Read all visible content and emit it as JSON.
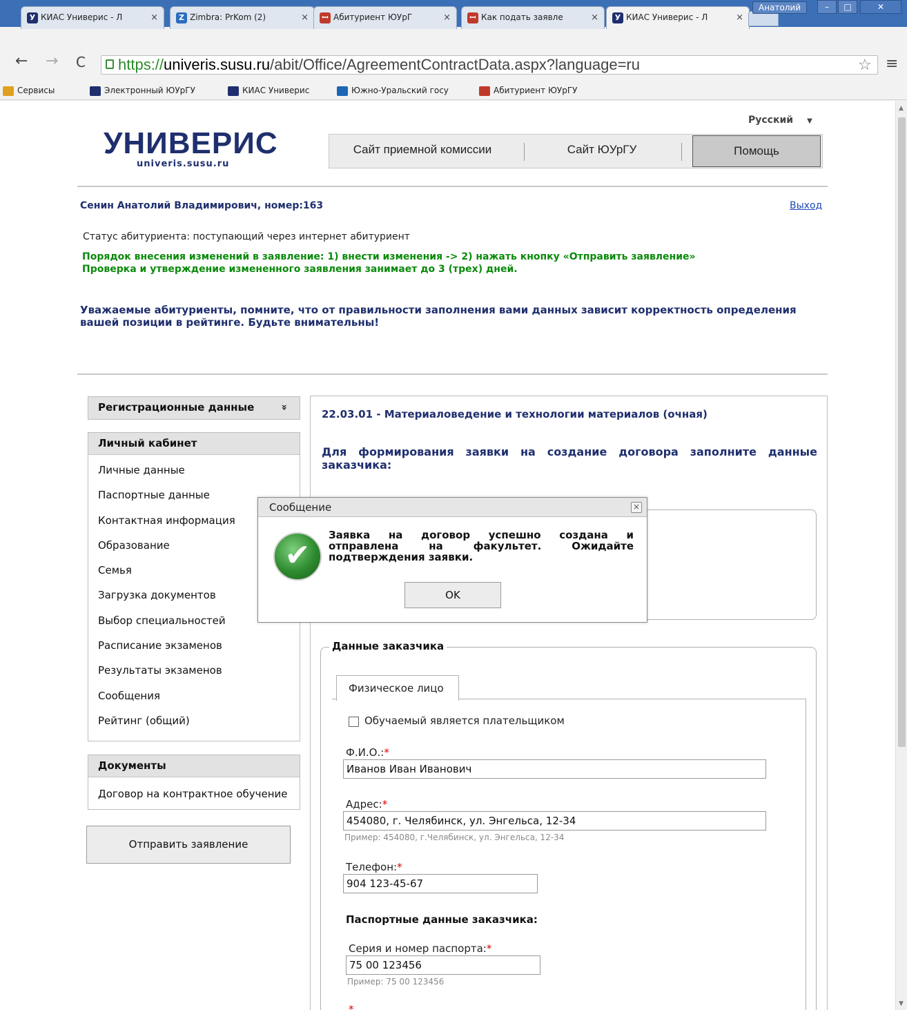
{
  "browser": {
    "tabs": [
      {
        "title": "КИАС Универис - Л",
        "favicon": "univeris-icon",
        "close": "×"
      },
      {
        "title": "Zimbra: PrKom (2)",
        "favicon": "zimbra-icon",
        "close": "×"
      },
      {
        "title": "Абитуриент ЮУрГ",
        "favicon": "susu-icon",
        "close": "×"
      },
      {
        "title": "Как подать заявле",
        "favicon": "susu-icon",
        "close": "×"
      },
      {
        "title": "КИАС Универис - Л",
        "favicon": "univeris-icon",
        "close": "×"
      }
    ],
    "user": "Анатолий",
    "url_scheme": "https://",
    "url_domain": "univeris.susu.ru",
    "url_path": "/abit/Office/AgreementContractData.aspx?language=ru",
    "bookmarks": [
      "Сервисы",
      "Электронный ЮУрГУ",
      "КИАС Универис",
      "Южно-Уральский госу",
      "Абитуриент ЮУрГУ"
    ]
  },
  "header": {
    "logo_main": "УНИВЕРИС",
    "logo_sub": "univeris.susu.ru",
    "language": "Русский",
    "nav": [
      "Сайт приемной комиссии",
      "Сайт ЮУрГУ",
      "Помощь"
    ]
  },
  "user": {
    "name_line": "Сенин Анатолий Владимирович, номер:163",
    "logout": "Выход",
    "status": "Статус абитуриента: поступающий через интернет абитуриент"
  },
  "notices": {
    "green1": "Порядок внесения изменений в заявление: 1) внести изменения -> 2) нажать кнопку «Отправить заявление»",
    "green2": "Проверка и утверждение измененного заявления занимает до 3 (трех) дней.",
    "warn1": "Уважаемые абитуриенты, помните, что от правильности заполнения вами данных зависит корректность определения",
    "warn2": "вашей позиции в рейтинге. Будьте внимательны!"
  },
  "sidebar": {
    "reg_title": "Регистрационные данные",
    "reg_chevron": "»",
    "cabinet_title": "Личный кабинет",
    "items": [
      "Личные данные",
      "Паспортные данные",
      "Контактная информация",
      "Образование",
      "Семья",
      "Загрузка документов",
      "Выбор специальностей",
      "Расписание экзаменов",
      "Результаты экзаменов",
      "Сообщения",
      "Рейтинг (общий)"
    ],
    "docs_title": "Документы",
    "docs_items": [
      "Договор на контрактное обучение"
    ],
    "send_button": "Отправить заявление"
  },
  "main": {
    "program": "22.03.01 - Материаловедение и технологии материалов (очная)",
    "intro_line1": "Для формирования заявки на создание договора заполните данные",
    "intro_line2": "заказчика:",
    "customer_legend": "Данные заказчика",
    "tab_physical": "Физическое лицо",
    "payer_checkbox": "Обучаемый является плательщиком",
    "fio_label": "Ф.И.О.:",
    "fio_value": "Иванов Иван Иванович",
    "address_label": "Адрес:",
    "address_value": "454080, г. Челябинск, ул. Энгельса, 12-34",
    "address_hint": "Пример: 454080, г.Челябинск, ул. Энгельса, 12-34",
    "phone_label": "Телефон:",
    "phone_value": "904 123-45-67",
    "passport_header": "Паспортные данные заказчика:",
    "passport_label": "Серия и номер паспорта:",
    "passport_value": "75 00 123456",
    "passport_hint": "Пример: 75 00 123456",
    "required_mark": "*"
  },
  "dialog": {
    "title": "Сообщение",
    "close": "×",
    "icon": "check-icon",
    "line1": "Заявка на договор успешно создана и",
    "line2": "отправлена на факультет. Ожидайте",
    "line3": "подтверждения заявки.",
    "ok": "OK"
  },
  "colors": {
    "tabstrip": "#3b6fb6",
    "brand": "#1f2f6e",
    "notice_green": "#0a8a0a",
    "required": "#dd0000"
  }
}
